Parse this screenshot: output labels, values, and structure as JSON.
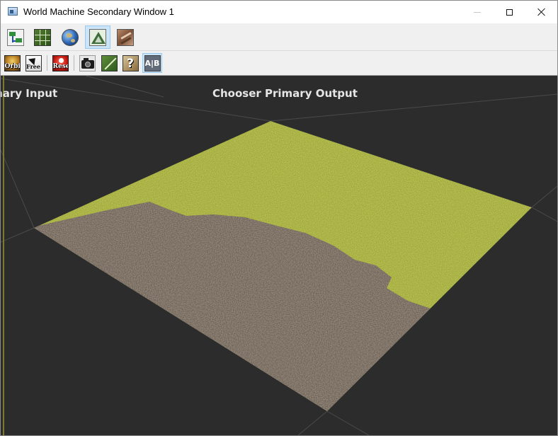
{
  "window": {
    "title": "World Machine Secondary Window 1",
    "icon": "app-window-icon",
    "controls": {
      "minimize_icon": "minimize-icon",
      "maximize_icon": "maximize-icon",
      "close_icon": "close-icon"
    }
  },
  "toolbar_top": {
    "buttons": [
      {
        "name": "workflow-view-button",
        "icon": "workflow-icon",
        "active": false
      },
      {
        "name": "layout-view-button",
        "icon": "layout-grid-icon",
        "active": false
      },
      {
        "name": "world-view-button",
        "icon": "globe-icon",
        "active": false
      },
      {
        "name": "3d-preview-button",
        "icon": "terrain-3d-icon",
        "active": true
      },
      {
        "name": "texture-view-button",
        "icon": "texture-icon",
        "active": false
      }
    ]
  },
  "toolbar_bottom": {
    "orbit_label": "Orbit",
    "free_label": "Free",
    "reset_label": "Reset",
    "ab_label": "A|B",
    "buttons": [
      {
        "name": "orbit-camera-button",
        "icon": "orbit-icon",
        "active": false
      },
      {
        "name": "free-camera-button",
        "icon": "free-camera-icon",
        "active": false
      },
      {
        "name": "reset-camera-button",
        "icon": "reset-icon",
        "active": false
      },
      {
        "name": "snapshot-button",
        "icon": "camera-icon",
        "active": false
      },
      {
        "name": "wireframe-button",
        "icon": "wireframe-icon",
        "active": false
      },
      {
        "name": "help-button",
        "icon": "help-icon",
        "active": false
      },
      {
        "name": "ab-compare-button",
        "icon": "ab-compare-icon",
        "active": true
      }
    ]
  },
  "viewport": {
    "left_label": "imary Input",
    "right_label": "Chooser Primary Output",
    "background_color": "#2c2c2c",
    "grass_color": "#8f9a22",
    "dirt_color": "#5e5247"
  }
}
